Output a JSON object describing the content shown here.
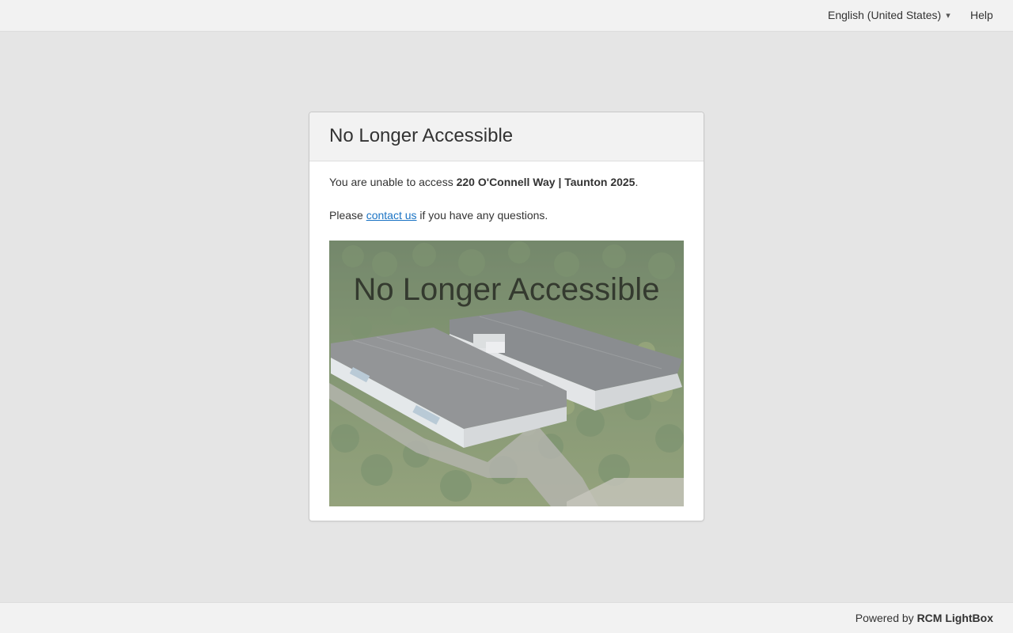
{
  "header": {
    "language": "English (United States)",
    "language_icon": "chevron-down-icon",
    "help": "Help"
  },
  "card": {
    "title": "No Longer Accessible",
    "message_prefix": "You are unable to access ",
    "property_name": "220 O'Connell Way | Taunton 2025",
    "message_suffix": ".",
    "contact_prefix": "Please ",
    "contact_link": "contact us",
    "contact_suffix": " if you have any questions."
  },
  "image": {
    "overlay_text": "No Longer Accessible"
  },
  "footer": {
    "powered_by": "Powered by",
    "brand": "RCM LightBox"
  }
}
